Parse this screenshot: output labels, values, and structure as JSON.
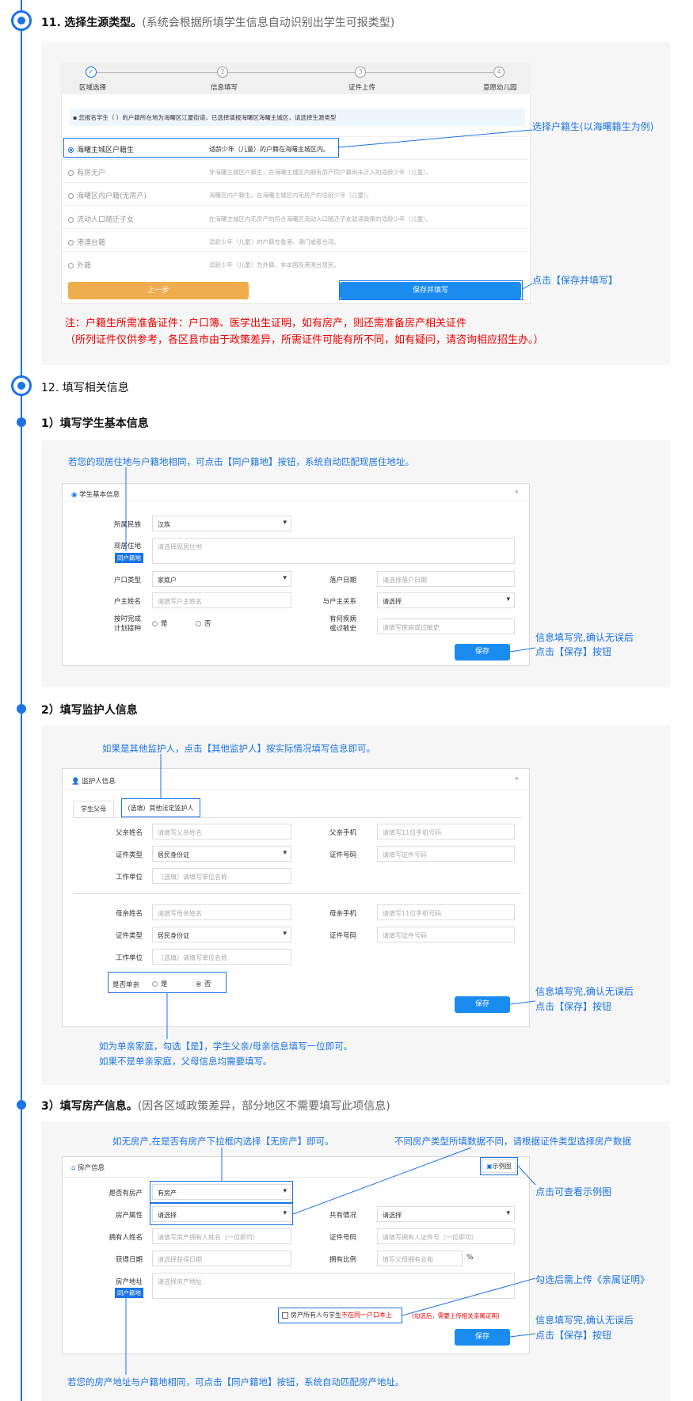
{
  "s11": {
    "num": "11.",
    "title": "选择生源类型。",
    "note": "(系统会根据所填学生信息自动识别出学生可报类型)"
  },
  "steps": [
    "区域选择",
    "信息填写",
    "证件上传",
    "意愿幼儿园"
  ],
  "step_nums": [
    "✓",
    "2",
    "3",
    "4"
  ],
  "notice": "▪ 您报名学生（                              ）的户籍所在地为海曙区江厦街道，已选择填报海曙区海曙主城区，请选择生源类型",
  "options": [
    {
      "name": "海曙主城区户籍生",
      "desc": "适龄少年（儿童）的户籍在海曙主城区内。"
    },
    {
      "name": "有房无户",
      "desc": "非海曙主城区户籍生，在海曙主城区内拥有房产同户籍尚未迁入的适龄少年（儿童）。"
    },
    {
      "name": "海曙区内户籍(无房产)",
      "desc": "海曙区内户籍生，在海曙主城区内无房产的适龄少年（儿童）。"
    },
    {
      "name": "流动人口随迁子女",
      "desc": "在海曙主城区内无房产的符合海曙区流动人口随迁子女就读政策的适龄少年（儿童）。"
    },
    {
      "name": "港澳台籍",
      "desc": "适龄少年（儿童）的户籍在香港、澳门或者台湾。"
    },
    {
      "name": "外籍",
      "desc": "适龄少年（儿童）为外籍、非本国及港澳台居民。"
    }
  ],
  "btn_prev": "上一步",
  "btn_save_fill": "保存并填写",
  "call_household": "选择户籍生(以海曙籍生为例)",
  "call_save_fill": "点击【保存并填写】",
  "warn1": "注：户籍生所需准备证件：户口簿、医学出生证明，如有房产，则还需准备房产相关证件",
  "warn2": "（所列证件仅供参考，各区县市由于政策差异，所需证件可能有所不同，如有疑问，请咨询相应招生办。）",
  "s12": {
    "title": "12. 填写相关信息"
  },
  "s12_1": {
    "title": "1）填写学生基本信息"
  },
  "note_same_addr": "若您的现居住地与户籍地相同，可点击【同户籍地】按钮，系统自动匹配现居住地址。",
  "basic": {
    "header": "学生基本信息",
    "ethnic_l": "所属民族",
    "ethnic_v": "汉族",
    "addr_l": "现居住地",
    "addr_ph": "请选择现居住地",
    "same_btn": "同户籍地",
    "htype_l": "户口类型",
    "htype_v": "家庭户",
    "hdate_l": "落户日期",
    "hdate_ph": "请选择落户日期",
    "hname_l": "户主姓名",
    "hname_ph": "请填写户主姓名",
    "rel_l": "与户主关系",
    "rel_v": "请选择",
    "vac_l1": "按时完成",
    "vac_l2": "计划接种",
    "yes": "是",
    "no": "否",
    "ill_l1": "有何疾病",
    "ill_l2": "或过敏史",
    "ill_ph": "请填写疾病或过敏史",
    "save": "保存"
  },
  "call_save1": "信息填写完,确认无误后",
  "call_save2": "点击【保存】按钮",
  "s12_2": {
    "title": "2）填写监护人信息"
  },
  "note_other_guard": "如果是其他监护人，点击【其他监护人】按实际情况填写信息即可。",
  "guard": {
    "header": "监护人信息",
    "tab1": "学生父母",
    "tab2": "(选填）其他法定监护人",
    "f_name_l": "父亲姓名",
    "f_name_ph": "请填写父亲姓名",
    "f_phone_l": "父亲手机",
    "f_phone_ph": "请填写11位手机号码",
    "idtype_l": "证件类型",
    "idtype_v": "居民身份证",
    "idno_l": "证件号码",
    "idno_ph": "请填写证件号码",
    "work_l": "工作单位",
    "work_ph": "（选填）请填写单位名称",
    "m_name_l": "母亲姓名",
    "m_name_ph": "请填写母亲姓名",
    "m_phone_l": "母亲手机",
    "single_l": "是否单亲",
    "save": "保存"
  },
  "note_single1": "如为单亲家庭，勾选【是】，学生父亲/母亲信息填写一位即可。",
  "note_single2": "如果不是单亲家庭，父母信息均需要填写。",
  "s12_3": {
    "title": "3）填写房产信息。",
    "note": "(因各区域政策差异，部分地区不需要填写此项信息)"
  },
  "note_no_house": "如无房产,在是否有房产下拉框内选择【无房产】即可。",
  "note_house_type": "不同房产类型所填数据不同，请根据证件类型选择房产数据",
  "house": {
    "header": "房产信息",
    "example": "示例图",
    "has_l": "是否有房产",
    "has_v": "有房产",
    "prop_l": "房产属性",
    "prop_v": "请选择",
    "share_l": "共有情况",
    "share_v": "请选择",
    "owner_l": "拥有人姓名",
    "owner_ph": "请填写房产拥有人姓名（一位即可）",
    "idno_l": "证件号码",
    "idno_ph": "请填写拥有人证件号（一位即可）",
    "date_l": "获得日期",
    "date_ph": "请选择获得日期",
    "ratio_l": "拥有比例",
    "ratio_ph": "填写父母拥有总和",
    "pct": "%",
    "addr_l": "房产地址",
    "addr_ph": "请选择房产地址",
    "same_btn": "同户籍地",
    "chk": "房产所有人与学生",
    "chk_red": "不在同一户口本上",
    "chk_note": "(勾选后，需要上传相关亲属证明)",
    "save": "保存"
  },
  "call_example": "点击可查看示例图",
  "call_kin": "勾选后需上传《亲属证明》",
  "note_house_addr": "若您的房产地址与户籍地相同，可点击【同户籍地】按钮，系统自动匹配房产地址。"
}
